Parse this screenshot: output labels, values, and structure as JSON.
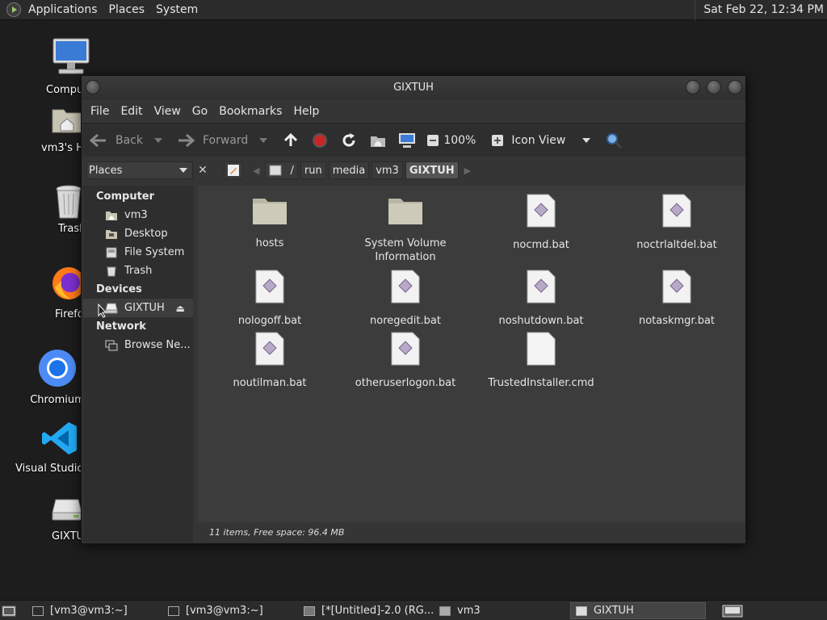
{
  "top_panel": {
    "menus": [
      "Applications",
      "Places",
      "System"
    ],
    "clock": "Sat Feb 22, 12:34 PM"
  },
  "desktop": {
    "icons": [
      {
        "label": "Compu",
        "icon": "computer-icon"
      },
      {
        "label": "vm3's H",
        "icon": "home-folder-icon"
      },
      {
        "label": "Trash",
        "icon": "trash-icon"
      },
      {
        "label": "Firefo",
        "icon": "firefox-icon"
      },
      {
        "label": "Chromium",
        "icon": "chromium-icon"
      },
      {
        "label": "Visual Studio C",
        "icon": "vscode-icon"
      },
      {
        "label": "GIXTU",
        "icon": "drive-icon"
      }
    ]
  },
  "window": {
    "title": "GIXTUH",
    "menus": [
      "File",
      "Edit",
      "View",
      "Go",
      "Bookmarks",
      "Help"
    ],
    "toolbar": {
      "back": "Back",
      "forward": "Forward",
      "zoom": "100%",
      "view_mode": "Icon View"
    },
    "location": {
      "places_label": "Places",
      "root": "/",
      "crumbs": [
        "run",
        "media",
        "vm3",
        "GIXTUH"
      ]
    },
    "sidebar": {
      "computer_header": "Computer",
      "computer_items": [
        "vm3",
        "Desktop",
        "File System",
        "Trash"
      ],
      "devices_header": "Devices",
      "device_items": [
        "GIXTUH"
      ],
      "network_header": "Network",
      "network_items": [
        "Browse Ne..."
      ]
    },
    "files": [
      {
        "name": "hosts",
        "type": "folder"
      },
      {
        "name": "System Volume Information",
        "type": "folder"
      },
      {
        "name": "nocmd.bat",
        "type": "script"
      },
      {
        "name": "noctrlaltdel.bat",
        "type": "script"
      },
      {
        "name": "nologoff.bat",
        "type": "script"
      },
      {
        "name": "noregedit.bat",
        "type": "script"
      },
      {
        "name": "noshutdown.bat",
        "type": "script"
      },
      {
        "name": "notaskmgr.bat",
        "type": "script"
      },
      {
        "name": "noutilman.bat",
        "type": "script"
      },
      {
        "name": "otheruserlogon.bat",
        "type": "script"
      },
      {
        "name": "TrustedInstaller.cmd",
        "type": "document"
      }
    ],
    "status": "11 items, Free space: 96.4 MB"
  },
  "taskbar": {
    "tasks": [
      "[vm3@vm3:~]",
      "[vm3@vm3:~]",
      "[*[Untitled]-2.0 (RG...",
      "vm3",
      "GIXTUH"
    ]
  }
}
